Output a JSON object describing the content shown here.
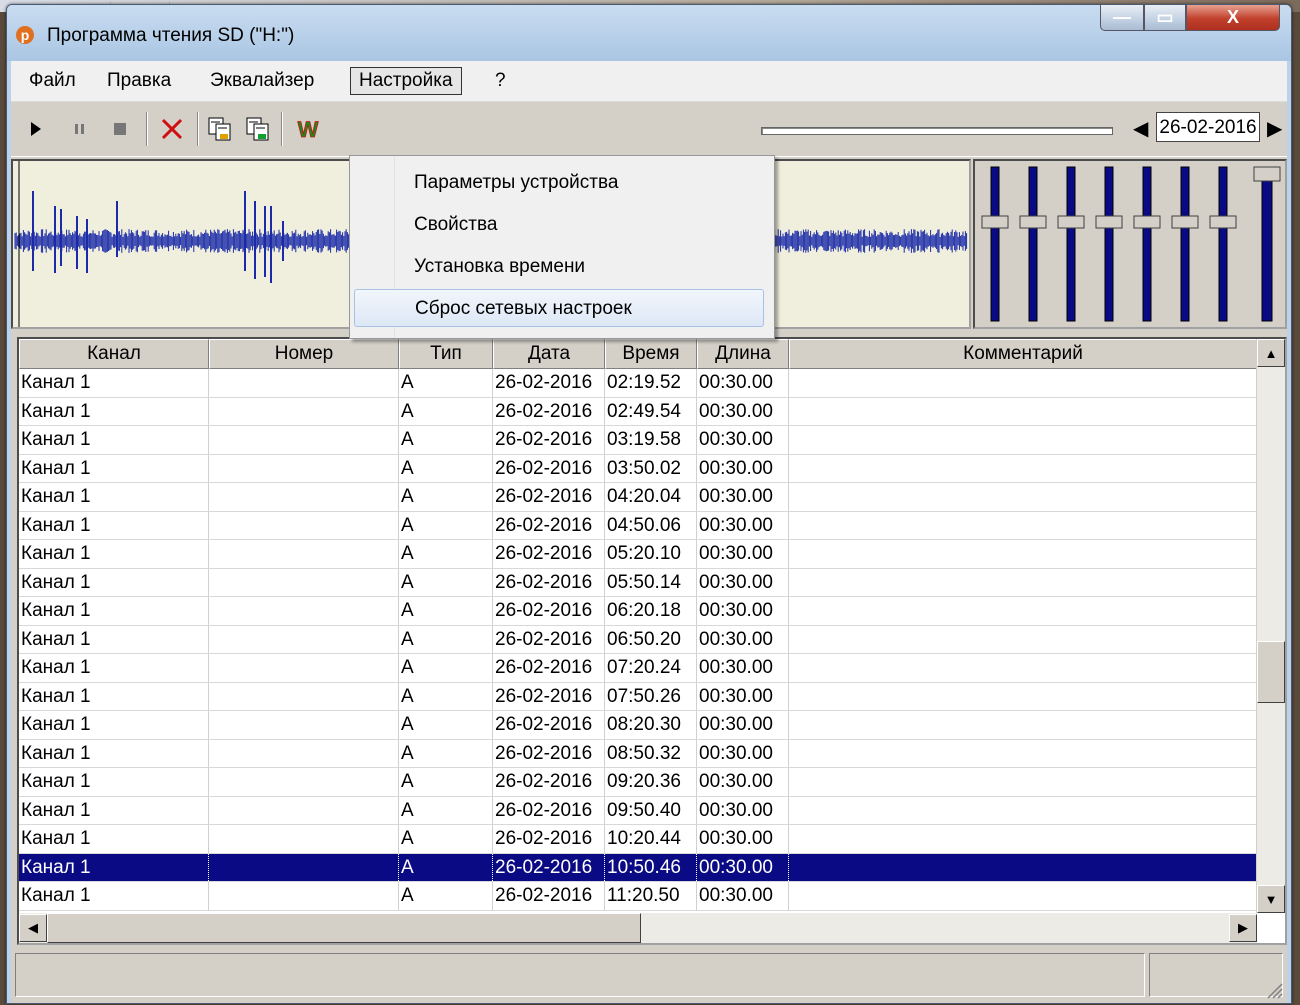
{
  "window": {
    "title": "Программа чтения SD (\"H:\")",
    "minimize_label": "—",
    "maximize_label": "▭",
    "close_label": "X"
  },
  "menu": {
    "items": [
      "Файл",
      "Правка",
      "Эквалайзер",
      "Настройка",
      "?"
    ],
    "active_index": 3
  },
  "dropdown": {
    "items": [
      "Параметры устройства",
      "Свойства",
      "Установка времени",
      "Сброс сетевых настроек"
    ],
    "hover_index": 3
  },
  "toolbar": {
    "icons": [
      "play-icon",
      "pause-icon",
      "stop-icon",
      "delete-icon",
      "export-icon",
      "export-all-icon",
      "wave-icon"
    ],
    "date_value": "26-02-2016",
    "prev_arrow": "◀",
    "next_arrow": "▶"
  },
  "equalizer": {
    "band_count": 7,
    "levels": [
      0.5,
      0.5,
      0.5,
      0.5,
      0.5,
      0.5,
      0.5
    ],
    "volume": 1.0
  },
  "table": {
    "columns": [
      "Канал",
      "Номер",
      "Тип",
      "Дата",
      "Время",
      "Длина",
      "Комментарий"
    ],
    "selected_index": 17,
    "rows": [
      [
        "Канал 1",
        "",
        "A",
        "26-02-2016",
        "02:19.52",
        "00:30.00",
        ""
      ],
      [
        "Канал 1",
        "",
        "A",
        "26-02-2016",
        "02:49.54",
        "00:30.00",
        ""
      ],
      [
        "Канал 1",
        "",
        "A",
        "26-02-2016",
        "03:19.58",
        "00:30.00",
        ""
      ],
      [
        "Канал 1",
        "",
        "A",
        "26-02-2016",
        "03:50.02",
        "00:30.00",
        ""
      ],
      [
        "Канал 1",
        "",
        "A",
        "26-02-2016",
        "04:20.04",
        "00:30.00",
        ""
      ],
      [
        "Канал 1",
        "",
        "A",
        "26-02-2016",
        "04:50.06",
        "00:30.00",
        ""
      ],
      [
        "Канал 1",
        "",
        "A",
        "26-02-2016",
        "05:20.10",
        "00:30.00",
        ""
      ],
      [
        "Канал 1",
        "",
        "A",
        "26-02-2016",
        "05:50.14",
        "00:30.00",
        ""
      ],
      [
        "Канал 1",
        "",
        "A",
        "26-02-2016",
        "06:20.18",
        "00:30.00",
        ""
      ],
      [
        "Канал 1",
        "",
        "A",
        "26-02-2016",
        "06:50.20",
        "00:30.00",
        ""
      ],
      [
        "Канал 1",
        "",
        "A",
        "26-02-2016",
        "07:20.24",
        "00:30.00",
        ""
      ],
      [
        "Канал 1",
        "",
        "A",
        "26-02-2016",
        "07:50.26",
        "00:30.00",
        ""
      ],
      [
        "Канал 1",
        "",
        "A",
        "26-02-2016",
        "08:20.30",
        "00:30.00",
        ""
      ],
      [
        "Канал 1",
        "",
        "A",
        "26-02-2016",
        "08:50.32",
        "00:30.00",
        ""
      ],
      [
        "Канал 1",
        "",
        "A",
        "26-02-2016",
        "09:20.36",
        "00:30.00",
        ""
      ],
      [
        "Канал 1",
        "",
        "A",
        "26-02-2016",
        "09:50.40",
        "00:30.00",
        ""
      ],
      [
        "Канал 1",
        "",
        "A",
        "26-02-2016",
        "10:20.44",
        "00:30.00",
        ""
      ],
      [
        "Канал 1",
        "",
        "A",
        "26-02-2016",
        "10:50.46",
        "00:30.00",
        ""
      ],
      [
        "Канал 1",
        "",
        "A",
        "26-02-2016",
        "11:20.50",
        "00:30.00",
        ""
      ]
    ]
  },
  "colors": {
    "selection": "#0a0a84",
    "waveform": "#1a2aa8",
    "eq_bar": "#0a0a84"
  }
}
